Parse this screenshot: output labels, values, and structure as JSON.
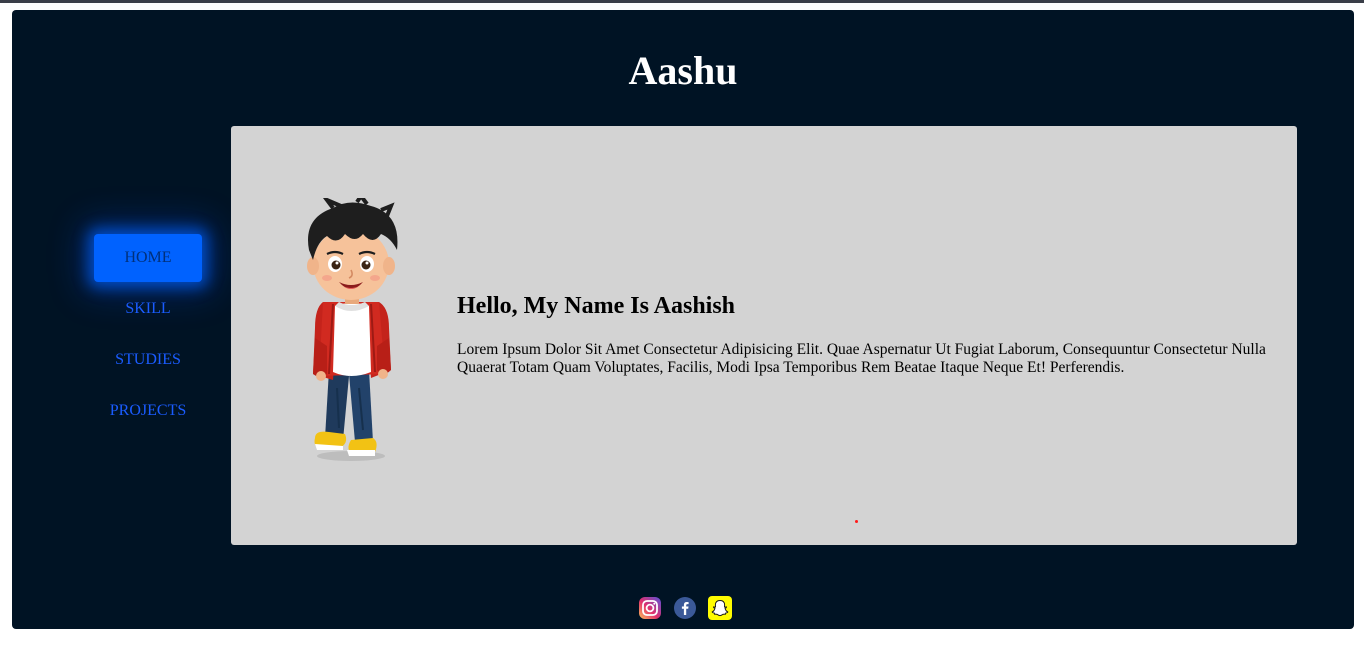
{
  "site": {
    "title": "Aashu"
  },
  "nav": {
    "items": [
      {
        "label": "HOME",
        "active": true
      },
      {
        "label": "SKILL",
        "active": false
      },
      {
        "label": "STUDIES",
        "active": false
      },
      {
        "label": "PROJECTS",
        "active": false
      }
    ]
  },
  "intro": {
    "heading": "Hello, My Name Is Aashish",
    "text": "Lorem Ipsum Dolor Sit Amet Consectetur Adipisicing Elit. Quae Aspernatur Ut Fugiat Laborum, Consequuntur Consectetur Nulla Quaerat Totam Quam Voluptates, Facilis, Modi Ipsa Temporibus Rem Beatae Itaque Neque Et! Perferendis.",
    "image": "cartoon-boy-illustration"
  },
  "social": {
    "icons": [
      "instagram-icon",
      "facebook-icon",
      "snapchat-icon"
    ]
  },
  "colors": {
    "background": "#001324",
    "card": "#d3d3d3",
    "accent": "#0062ff",
    "nav_text": "#1a5cff"
  }
}
